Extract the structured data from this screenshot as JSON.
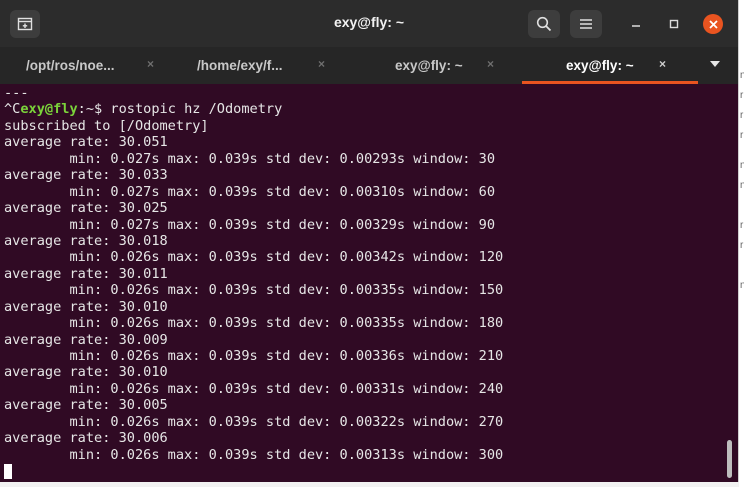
{
  "window": {
    "title": "exy@fly: ~"
  },
  "tabs": [
    {
      "label": "/opt/ros/noe...",
      "close": "×",
      "active": false
    },
    {
      "label": "/home/exy/f...",
      "close": "×",
      "active": false
    },
    {
      "label": "exy@fly: ~",
      "close": "×",
      "active": false
    },
    {
      "label": "exy@fly: ~",
      "close": "×",
      "active": true
    }
  ],
  "icons": {
    "new_tab": "new-tab-icon",
    "search": "search-icon",
    "menu": "hamburger-menu-icon",
    "minimize": "minimize-icon",
    "maximize": "maximize-icon",
    "close": "close-icon",
    "tab_list": "chevron-down-icon"
  },
  "colors": {
    "terminal_bg": "#300a24",
    "accent": "#e95420",
    "prompt_user": "#7bd33a",
    "headerbar": "#2c2c2c"
  },
  "terminal": {
    "prompt_prefix": "^C",
    "prompt_user": "exy@fly",
    "prompt_suffix": ":~$ rostopic hz /Odometry",
    "lines": [
      "---",
      "subscribed to [/Odometry]",
      "average rate: 30.051",
      "        min: 0.027s max: 0.039s std dev: 0.00293s window: 30",
      "average rate: 30.033",
      "        min: 0.027s max: 0.039s std dev: 0.00310s window: 60",
      "average rate: 30.025",
      "        min: 0.027s max: 0.039s std dev: 0.00329s window: 90",
      "average rate: 30.018",
      "        min: 0.026s max: 0.039s std dev: 0.00342s window: 120",
      "average rate: 30.011",
      "        min: 0.026s max: 0.039s std dev: 0.00335s window: 150",
      "average rate: 30.010",
      "        min: 0.026s max: 0.039s std dev: 0.00335s window: 180",
      "average rate: 30.009",
      "        min: 0.026s max: 0.039s std dev: 0.00336s window: 210",
      "average rate: 30.010",
      "        min: 0.026s max: 0.039s std dev: 0.00331s window: 240",
      "average rate: 30.005",
      "        min: 0.026s max: 0.039s std dev: 0.00322s window: 270",
      "average rate: 30.006",
      "        min: 0.026s max: 0.039s std dev: 0.00313s window: 300"
    ]
  }
}
